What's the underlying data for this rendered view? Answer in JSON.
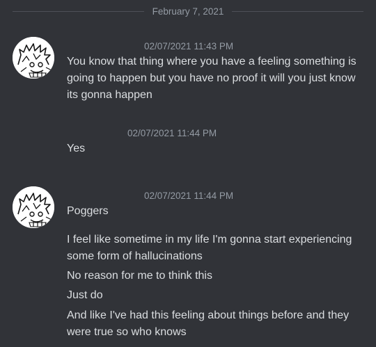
{
  "date_divider": "February 7, 2021",
  "groups": [
    {
      "avatar_icon": "sketch-cat-avatar",
      "timestamp": "02/07/2021 11:43 PM",
      "messages": [
        "You know that thing where you have a feeling something is going to happen but you have no proof it will you just know its gonna happen"
      ]
    },
    {
      "timestamp": "02/07/2021 11:44 PM",
      "messages": [
        "Yes"
      ]
    },
    {
      "avatar_icon": "sketch-cat-avatar",
      "timestamp": "02/07/2021 11:44 PM",
      "messages": [
        "Poggers",
        "I feel like sometime in my life I'm gonna start experiencing some form of hallucinations",
        "No reason for me to think this",
        "Just do",
        "And like I've had this feeling about things before and they were true so who knows"
      ]
    }
  ]
}
